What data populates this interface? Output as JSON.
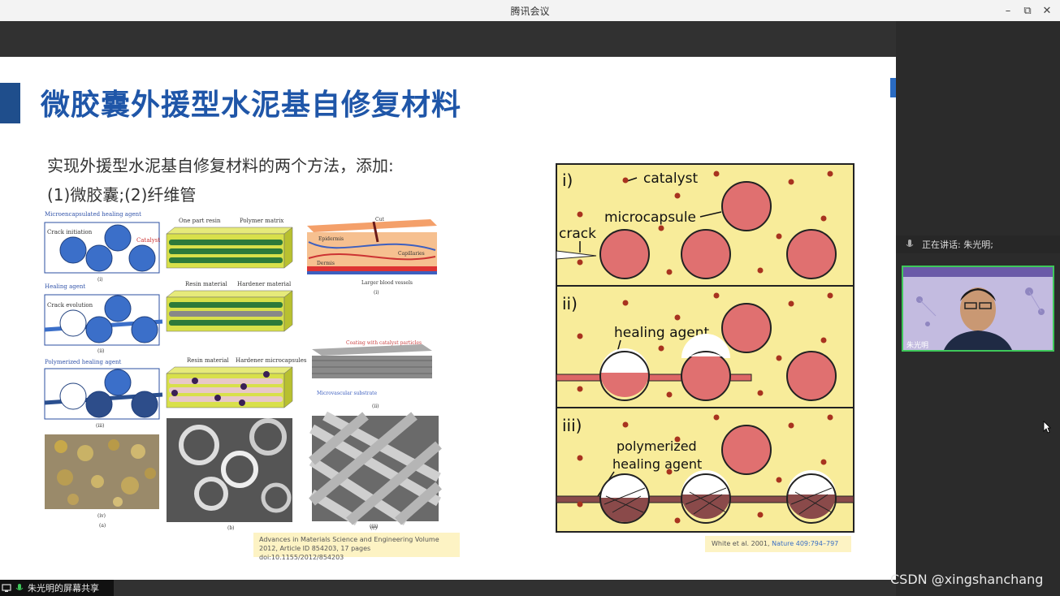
{
  "window": {
    "title": "腾讯会议",
    "minimize": "–",
    "restore": "⧉",
    "close": "✕"
  },
  "slide": {
    "title": "微胶囊外援型水泥基自修复材料",
    "line1": "实现外援型水泥基自修复材料的两个方法，添加:",
    "line2": "(1)微胶囊;(2)纤维管",
    "left_figure": {
      "panel_a_labels": [
        "Microencapsulated healing agent",
        "Crack initiation",
        "Catalyst",
        "(i)",
        "Healing agent",
        "Crack evolution",
        "(ii)",
        "Polymerized healing agent",
        "(iii)",
        "(iv)",
        "(a)"
      ],
      "panel_b_labels": [
        "One part resin",
        "Polymer matrix",
        "Resin material",
        "Hardener material",
        "Resin material",
        "Hardener microcapsules",
        "(b)"
      ],
      "panel_c_labels": [
        "Cut",
        "Epidermis",
        "Capillaries",
        "Dermis",
        "Larger blood vessels",
        "(i)",
        "Coating with catalyst particles",
        "Microvascular substrate",
        "(ii)",
        "(iii)",
        "(c)"
      ]
    },
    "right_figure": {
      "panel_i": "i)",
      "panel_ii": "ii)",
      "panel_iii": "iii)",
      "catalyst": "catalyst",
      "microcapsule": "microcapsule",
      "crack": "crack",
      "healing_agent": "healing agent",
      "polymerized_1": "polymerized",
      "polymerized_2": "healing agent"
    },
    "citation_left": "Advances in Materials Science and Engineering Volume 2012, Article ID 854203, 17 pages doi:10.1155/2012/854203",
    "citation_right_text": "White et al. 2001,",
    "citation_right_link": "Nature 409:794–797"
  },
  "sidebar": {
    "speaking_label": "正在讲话: 朱光明;",
    "participant_name": "朱光明"
  },
  "bottom": {
    "share_label": "朱光明的屏幕共享"
  },
  "watermark": "CSDN @xingshanchang"
}
